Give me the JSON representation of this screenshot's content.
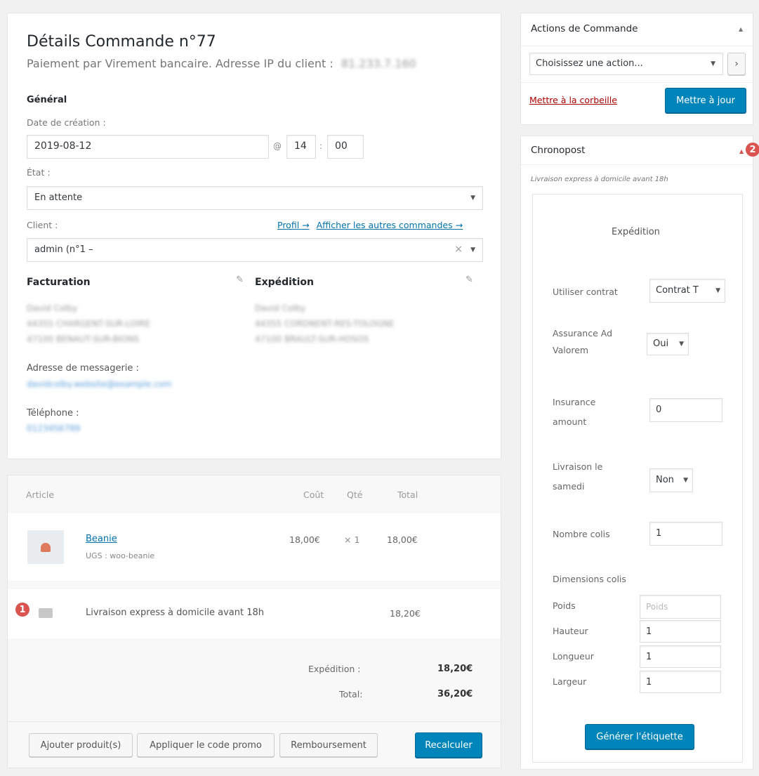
{
  "order": {
    "title": "Détails Commande n°77",
    "subtitle": "Paiement par Virement bancaire. Adresse IP du client :",
    "ip_blurred": "81.233.7.160",
    "general_heading": "Général",
    "creation_date_label": "Date de création :",
    "creation_date": "2019-08-12",
    "at_symbol": "@",
    "hour": "14",
    "colon": ":",
    "minute": "00",
    "status_label": "État :",
    "status_value": "En attente",
    "customer_label": "Client :",
    "profile_link": "Profil →",
    "other_orders_link": "Afficher les autres commandes →",
    "customer_value": "admin (n°1 –",
    "customer_clear": "×",
    "billing_heading": "Facturation",
    "shipping_heading": "Expédition",
    "billing_blurred": [
      "David Colby",
      "44355 CHARGENT-SUR-LOIRE",
      "47100 BENAUT-SUR-BIONS"
    ],
    "shipping_blurred": [
      "David Colby",
      "44355 CORDNENT-RES-TOLOGNE",
      "47100 BRAULT-SUR-HOSOS"
    ],
    "email_label": "Adresse de messagerie :",
    "email_blurred": "davidcolby.website@example.com",
    "phone_label": "Téléphone :",
    "phone_blurred": "0123456789"
  },
  "items": {
    "headers": {
      "article": "Article",
      "cost": "Coût",
      "qty": "Qté",
      "total": "Total"
    },
    "product": {
      "name": "Beanie",
      "sku": "UGS : woo-beanie",
      "cost": "18,00€",
      "qty": "× 1",
      "total": "18,00€"
    },
    "shipping_line": {
      "name": "Livraison express à domicile avant 18h",
      "total": "18,20€"
    },
    "totals": {
      "shipping_label": "Expédition :",
      "shipping_value": "18,20€",
      "total_label": "Total:",
      "total_value": "36,20€"
    },
    "buttons": {
      "add_products": "Ajouter produit(s)",
      "apply_coupon": "Appliquer le code promo",
      "refund": "Remboursement",
      "recalculate": "Recalculer"
    }
  },
  "actions_box": {
    "title": "Actions de Commande",
    "select_placeholder": "Choisissez une action...",
    "go": "›",
    "trash_link": "Mettre à la corbeille",
    "update_button": "Mettre à jour"
  },
  "chronopost": {
    "title": "Chronopost",
    "method": "Livraison express à domicile avant 18h",
    "shipment_heading": "Expédition",
    "use_contract_label": "Utiliser contrat",
    "use_contract_value": "Contrat T",
    "insurance_label": "Assurance Ad Valorem",
    "insurance_value": "Oui",
    "insurance_amount_label": "Insurance amount",
    "insurance_amount_value": "0",
    "saturday_label": "Livraison le samedi",
    "saturday_value": "Non",
    "parcels_label": "Nombre colis",
    "parcels_value": "1",
    "dimensions_label": "Dimensions colis",
    "weight_label": "Poids",
    "weight_placeholder": "Poids",
    "height_label": "Hauteur",
    "height_value": "1",
    "length_label": "Longueur",
    "length_value": "1",
    "width_label": "Largeur",
    "width_value": "1",
    "generate_button": "Générer l'étiquette"
  },
  "markers": {
    "one": "1",
    "two": "2"
  },
  "icons": {
    "pencil": "pencil-icon",
    "caret_up": "caret-up-icon",
    "caret_down": "caret-down-icon"
  }
}
